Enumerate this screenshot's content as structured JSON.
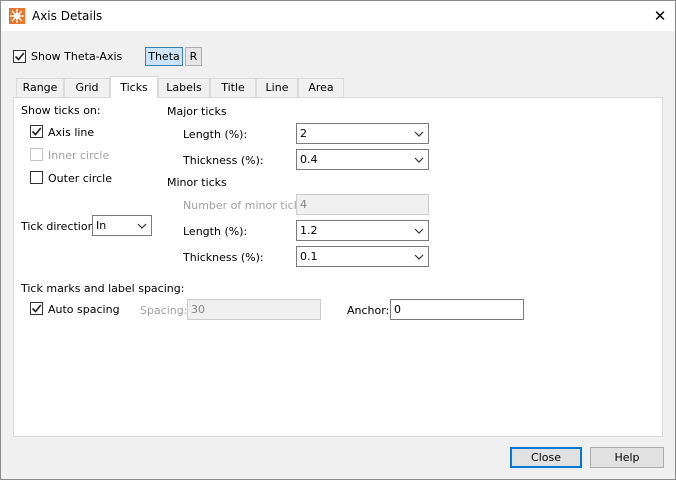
{
  "window": {
    "title": "Axis Details"
  },
  "show_axis": {
    "label": "Show Theta-Axis",
    "checked": true
  },
  "axis_toggle": {
    "theta": "Theta",
    "r": "R"
  },
  "tabs": [
    {
      "label": "Range"
    },
    {
      "label": "Grid"
    },
    {
      "label": "Ticks",
      "active": true
    },
    {
      "label": "Labels"
    },
    {
      "label": "Title"
    },
    {
      "label": "Line"
    },
    {
      "label": "Area"
    }
  ],
  "show_ticks": {
    "heading": "Show ticks on:",
    "axis_line": {
      "label": "Axis line",
      "checked": true
    },
    "inner_circle": {
      "label": "Inner circle",
      "checked": false,
      "disabled": true
    },
    "outer_circle": {
      "label": "Outer circle",
      "checked": false
    }
  },
  "tick_direction": {
    "label": "Tick direction:",
    "value": "In"
  },
  "major": {
    "heading": "Major ticks",
    "length_label": "Length (%):",
    "length_value": "2",
    "thickness_label": "Thickness (%):",
    "thickness_value": "0.4"
  },
  "minor": {
    "heading": "Minor ticks",
    "count_label": "Number of minor ticks:",
    "count_value": "4",
    "length_label": "Length (%):",
    "length_value": "1.2",
    "thickness_label": "Thickness (%):",
    "thickness_value": "0.1"
  },
  "spacing": {
    "heading": "Tick marks and label spacing:",
    "auto": {
      "label": "Auto spacing",
      "checked": true
    },
    "spacing_label": "Spacing:",
    "spacing_value": "30",
    "anchor_label": "Anchor:",
    "anchor_value": "0"
  },
  "buttons": {
    "close": "Close",
    "help": "Help"
  },
  "colors": {
    "accent": "#0078d7",
    "selected_toggle": "#cce4f7",
    "app_icon": "#e8762c"
  }
}
